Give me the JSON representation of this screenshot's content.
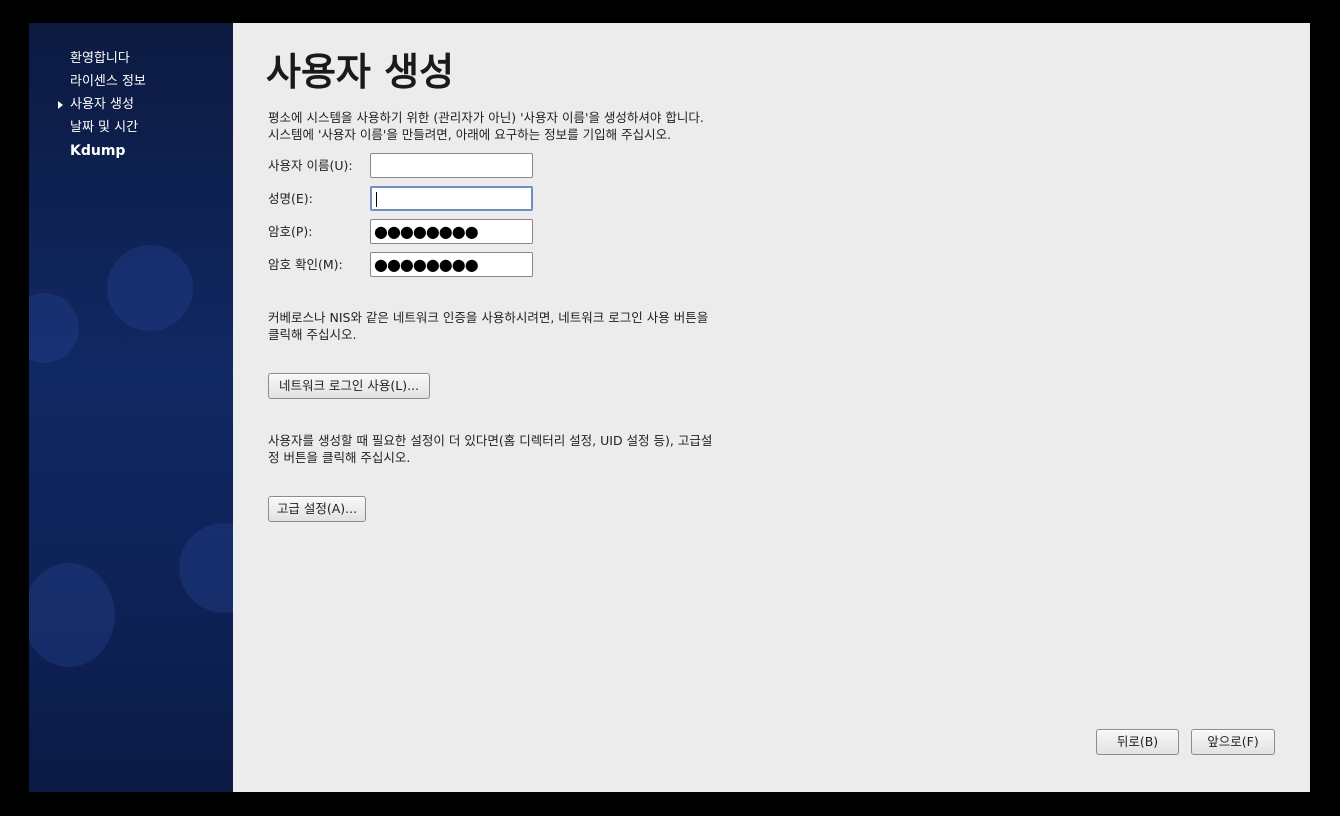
{
  "sidebar": {
    "items": [
      {
        "label": "환영합니다"
      },
      {
        "label": "라이센스 정보"
      },
      {
        "label": "사용자 생성"
      },
      {
        "label": "날짜 및 시간"
      },
      {
        "label": "Kdump"
      }
    ]
  },
  "main": {
    "title": "사용자 생성",
    "intro_line1": "평소에 시스템을 사용하기 위한 (관리자가 아닌) '사용자 이름'을 생성하셔야 합니다.",
    "intro_line2": "시스템에 '사용자 이름'을 만들려면, 아래에 요구하는 정보를 기입해 주십시오.",
    "fields": {
      "username": {
        "label": "사용자 이름(U):",
        "value": ""
      },
      "fullname": {
        "label": "성명(E):",
        "value": ""
      },
      "password": {
        "label": "암호(P):",
        "value": "●●●●●●●●"
      },
      "confirm": {
        "label": "암호 확인(M):",
        "value": "●●●●●●●●"
      }
    },
    "network_text_line1": "커베로스나 NIS와 같은 네트워크 인증을 사용하시려면, 네트워크 로그인 사용 버튼을",
    "network_text_line2": "클릭해 주십시오.",
    "network_button": "네트워크 로그인 사용(L)...",
    "advanced_text_line1": "사용자를 생성할 때 필요한 설정이 더 있다면(홈 디렉터리 설정, UID 설정 등), 고급설",
    "advanced_text_line2": "정 버튼을 클릭해 주십시오.",
    "advanced_button": "고급 설정(A)..."
  },
  "footer": {
    "back_button": "뒤로(B)",
    "forward_button": "앞으로(F)"
  }
}
